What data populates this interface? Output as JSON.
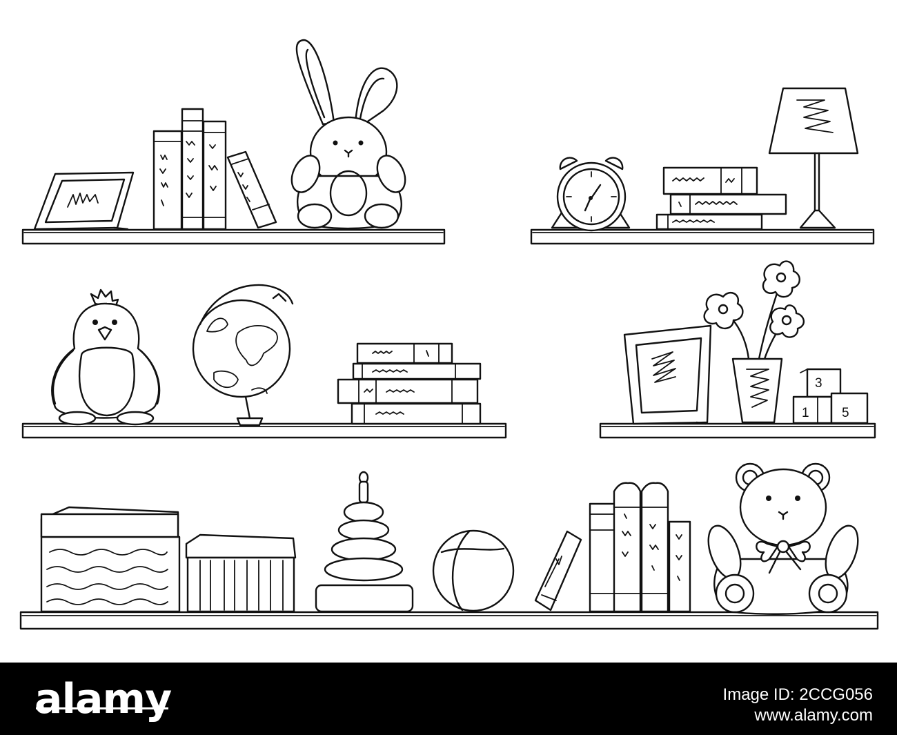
{
  "illustration": {
    "blocks_top": "3",
    "blocks_bottom_left": "1",
    "blocks_bottom_right": "5"
  },
  "footer": {
    "brand": "alamy",
    "image_id_label": "Image ID:",
    "image_id": "2CCG056",
    "site": "www.alamy.com"
  }
}
